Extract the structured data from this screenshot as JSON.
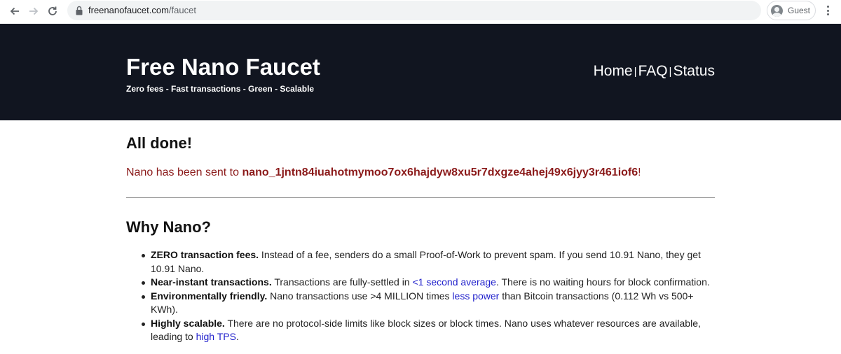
{
  "browser": {
    "url_host": "freenanofaucet.com",
    "url_path": "/faucet",
    "profile_label": "Guest"
  },
  "header": {
    "title": "Free Nano Faucet",
    "tagline": "Zero fees - Fast transactions - Green - Scalable",
    "nav": {
      "home": "Home",
      "faq": "FAQ",
      "status": "Status",
      "separator": "|"
    }
  },
  "result": {
    "title": "All done!",
    "message_prefix": "Nano has been sent to ",
    "address": "nano_1jntn84iuahotmymoo7ox6hajdyw8xu5r7dxgze4ahej49x6jyy3r461iof6",
    "message_suffix": "!"
  },
  "why": {
    "title": "Why Nano?",
    "items": [
      {
        "heading": "ZERO transaction fees.",
        "text_before": " Instead of a fee, senders do a small Proof-of-Work to prevent spam. If you send 10.91 Nano, they get 10.91 Nano.",
        "link": "",
        "text_after": ""
      },
      {
        "heading": "Near-instant transactions.",
        "text_before": " Transactions are fully-settled in ",
        "link": "<1 second average",
        "text_after": ". There is no waiting hours for block confirmation."
      },
      {
        "heading": "Environmentally friendly.",
        "text_before": " Nano transactions use >4 MILLION times ",
        "link": "less power",
        "text_after": " than Bitcoin transactions (0.112 Wh vs 500+ KWh)."
      },
      {
        "heading": "Highly scalable.",
        "text_before": " There are no protocol-side limits like block sizes or block times. Nano uses whatever resources are available, leading to ",
        "link": "high TPS",
        "text_after": "."
      }
    ]
  },
  "colors": {
    "header_bg": "#111520",
    "message": "#8b1a1a",
    "link": "#2222cc"
  }
}
